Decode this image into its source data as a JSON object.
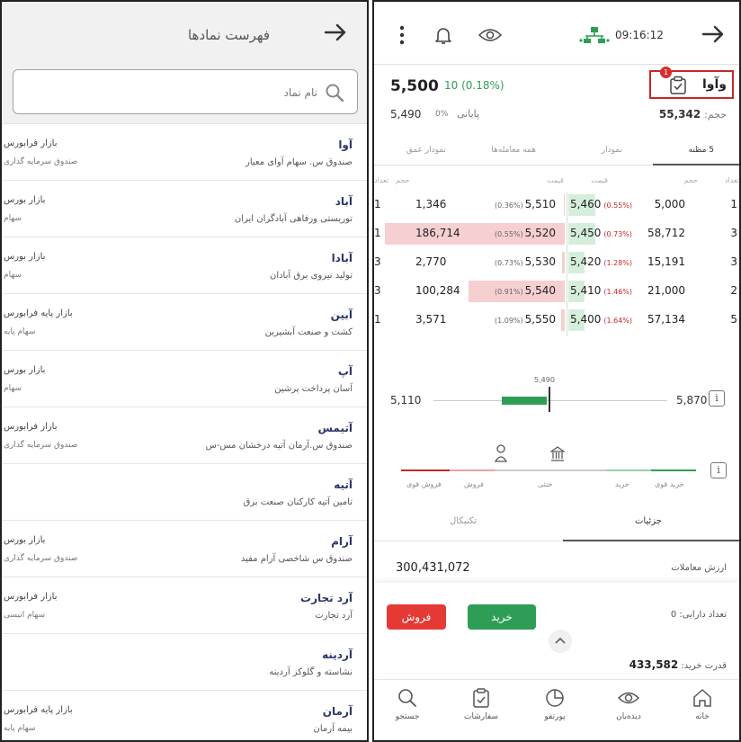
{
  "symbol_list": {
    "title": "فهرست نمادها",
    "search_placeholder": "نام نماد",
    "items": [
      {
        "symbol": "آوا",
        "name": "صندوق س. سهام آوای معیار",
        "market": "بازار فرابورس",
        "type": "صندوق سرمایه گذاری"
      },
      {
        "symbol": "آباد",
        "name": "توریستی ورفاهی آبادگران ایران",
        "market": "بازار بورس",
        "type": "سهام"
      },
      {
        "symbol": "آبادا",
        "name": "تولید نیروی برق آبادان",
        "market": "بازار بورس",
        "type": "سهام"
      },
      {
        "symbol": "آبین",
        "name": "کشت و صنعت آبشیرین",
        "market": "بازار پایه فرابورس",
        "type": "سهام پایه"
      },
      {
        "symbol": "آپ",
        "name": "آسان پرداخت پرشین",
        "market": "بازار بورس",
        "type": "سهام"
      },
      {
        "symbol": "آتیمس",
        "name": "صندوق س.آرمان آتیه درخشان مس-س",
        "market": "بازار فرابورس",
        "type": "صندوق سرمایه گذاری"
      },
      {
        "symbol": "آتیه",
        "name": "تامین آتیه کارکنان صنعت برق",
        "market": "",
        "type": ""
      },
      {
        "symbol": "آرام",
        "name": "صندوق س شاخصی آرام مفید",
        "market": "بازار بورس",
        "type": "صندوق سرمایه گذاری"
      },
      {
        "symbol": "آرد تجارت",
        "name": "آرد تجارت",
        "market": "بازار فرابورس",
        "type": "سهام اتیسی"
      },
      {
        "symbol": "آردینه",
        "name": "نشاسته و گلوکز آردینه",
        "market": "",
        "type": ""
      },
      {
        "symbol": "آرمان",
        "name": "بیمه آرمان",
        "market": "بازار پایه فرابورس",
        "type": "سهام پایه"
      }
    ]
  },
  "status_bar": {
    "time": "09:16:12"
  },
  "quote": {
    "symbol": "وآوا",
    "notification_count": "1",
    "last_price": "5,500",
    "change": "10 (0.18%)",
    "final_price": "5,490",
    "final_pct": "0%",
    "final_label": "پایانی",
    "volume_label": "حجم:",
    "volume": "55,342"
  },
  "tabs": [
    "5 مظنه",
    "نمودار",
    "همه معامله‌ها",
    "نمودار عمق"
  ],
  "orderbook": {
    "headers": {
      "buy_count": "تعداد",
      "buy_volume": "حجم",
      "buy_price": "قیمت",
      "sell_price": "قیمت",
      "sell_volume": "حجم",
      "sell_count": "تعداد"
    },
    "rows": [
      {
        "buy_count": "1",
        "buy_volume": "5,000",
        "buy_price": "5,460",
        "buy_pct": "(0.55%)",
        "sell_price": "5,510",
        "sell_pct": "(0.36%)",
        "sell_volume": "1,346",
        "sell_count": "1"
      },
      {
        "buy_count": "3",
        "buy_volume": "58,712",
        "buy_price": "5,450",
        "buy_pct": "(0.73%)",
        "sell_price": "5,520",
        "sell_pct": "(0.55%)",
        "sell_volume": "186,714",
        "sell_count": "1"
      },
      {
        "buy_count": "3",
        "buy_volume": "15,191",
        "buy_price": "5,420",
        "buy_pct": "(1.28%)",
        "sell_price": "5,530",
        "sell_pct": "(0.73%)",
        "sell_volume": "2,770",
        "sell_count": "3"
      },
      {
        "buy_count": "2",
        "buy_volume": "21,000",
        "buy_price": "5,410",
        "buy_pct": "(1.46%)",
        "sell_price": "5,540",
        "sell_pct": "(0.91%)",
        "sell_volume": "100,284",
        "sell_count": "3"
      },
      {
        "buy_count": "5",
        "buy_volume": "57,134",
        "buy_price": "5,400",
        "buy_pct": "(1.64%)",
        "sell_price": "5,550",
        "sell_pct": "(1.09%)",
        "sell_volume": "3,571",
        "sell_count": "1"
      }
    ]
  },
  "price_range": {
    "min": "5,110",
    "max": "5,870",
    "reference": "5,490"
  },
  "sentiment": {
    "labels": [
      "خرید قوی",
      "خرید",
      "خنثی",
      "فروش",
      "فروش قوی"
    ],
    "colors": {
      "strong_buy": "#2e9e57",
      "buy": "#9ccfaa",
      "neutral": "#cccccc",
      "sell": "#e8a3a6",
      "strong_sell": "#c62828"
    }
  },
  "detail_tabs": [
    "جزئیات",
    "تکنیکال"
  ],
  "trade_value": {
    "label": "ارزش معاملات",
    "value": "300,431,072"
  },
  "actions": {
    "sell": "فروش",
    "buy": "خرید",
    "holdings_label": "تعداد دارایی:",
    "holdings": "0",
    "buy_power_label": "قدرت خرید:",
    "buy_power": "433,582"
  },
  "bottom_nav": [
    "خانه",
    "دیده‌بان",
    "پورتفو",
    "سفارشات",
    "جستجو"
  ],
  "colors": {
    "green": "#2e9e57",
    "red": "#e53935",
    "navy": "#2a3866"
  }
}
